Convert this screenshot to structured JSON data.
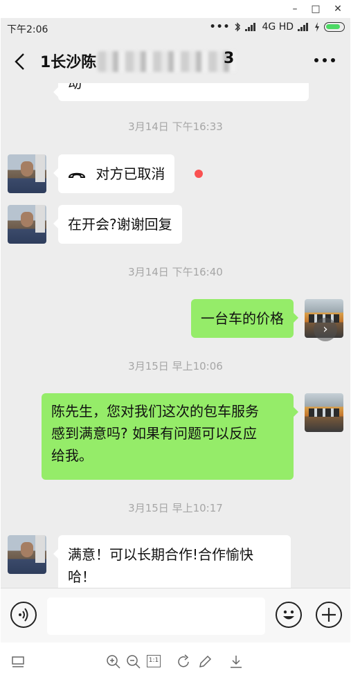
{
  "window": {
    "minimize": "–",
    "maximize": "□",
    "close": "✕"
  },
  "status_bar": {
    "time": "下午2:06",
    "dots": "•••",
    "network": "4G HD",
    "icons": [
      "bluetooth-icon",
      "signal-icon",
      "signal-icon",
      "charging-icon",
      "battery-icon"
    ]
  },
  "header": {
    "title_prefix": "1长沙陈",
    "title_suffix": "3",
    "title_obscured": true
  },
  "messages": [
    {
      "type": "partial_incoming",
      "text": "动"
    },
    {
      "type": "timestamp",
      "text": "3月14日 下午16:33"
    },
    {
      "type": "incoming_call",
      "icon": "phone-hangup-icon",
      "text": "对方已取消",
      "unread_dot": true
    },
    {
      "type": "incoming",
      "text": "在开会?谢谢回复"
    },
    {
      "type": "timestamp",
      "text": "3月14日 下午16:40"
    },
    {
      "type": "outgoing",
      "text": "一台车的价格"
    },
    {
      "type": "timestamp",
      "text": "3月15日 早上10:06"
    },
    {
      "type": "outgoing",
      "lines": [
        "陈先生，您对我们这次的包车服务",
        "感到满意吗? 如果有问题可以反应",
        "给我。"
      ]
    },
    {
      "type": "timestamp",
      "text": "3月15日 早上10:17"
    },
    {
      "type": "incoming",
      "lines": [
        "满意！可以长期合作!合作愉快",
        "哈！"
      ]
    }
  ],
  "input_bar": {
    "value": "",
    "icons": [
      "voice-icon",
      "emoji-icon",
      "plus-icon"
    ]
  },
  "toolbar": {
    "zoom_reset_label": "1:1",
    "icons": [
      "thumbnail-icon",
      "zoom-in-icon",
      "zoom-out-icon",
      "rotate-icon",
      "edit-icon",
      "download-icon"
    ]
  },
  "colors": {
    "chat_bg": "#ededed",
    "bubble_out": "#95ec69",
    "bubble_in": "#ffffff",
    "timestamp": "#a6a6a6",
    "unread_dot": "#fa5151"
  }
}
